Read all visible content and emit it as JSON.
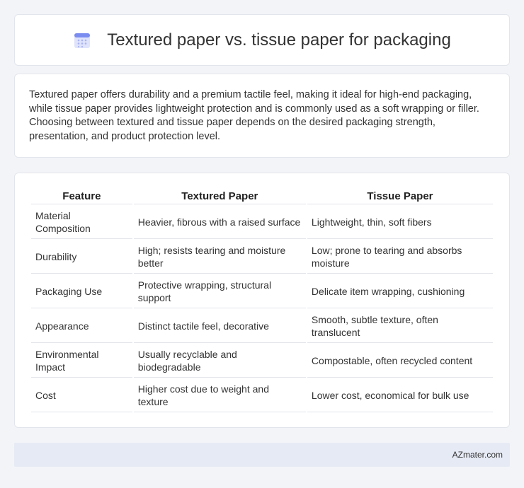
{
  "header": {
    "title": "Textured paper vs. tissue paper for packaging",
    "icon": "calendar-icon"
  },
  "intro": {
    "text": "Textured paper offers durability and a premium tactile feel, making it ideal for high-end packaging, while tissue paper provides lightweight protection and is commonly used as a soft wrapping or filler. Choosing between textured and tissue paper depends on the desired packaging strength, presentation, and product protection level."
  },
  "table": {
    "headers": [
      "Feature",
      "Textured Paper",
      "Tissue Paper"
    ],
    "rows": [
      [
        "Material Composition",
        "Heavier, fibrous with a raised surface",
        "Lightweight, thin, soft fibers"
      ],
      [
        "Durability",
        "High; resists tearing and moisture better",
        "Low; prone to tearing and absorbs moisture"
      ],
      [
        "Packaging Use",
        "Protective wrapping, structural support",
        "Delicate item wrapping, cushioning"
      ],
      [
        "Appearance",
        "Distinct tactile feel, decorative",
        "Smooth, subtle texture, often translucent"
      ],
      [
        "Environmental Impact",
        "Usually recyclable and biodegradable",
        "Compostable, often recycled content"
      ],
      [
        "Cost",
        "Higher cost due to weight and texture",
        "Lower cost, economical for bulk use"
      ]
    ]
  },
  "footer": {
    "brand": "AZmater.com"
  }
}
